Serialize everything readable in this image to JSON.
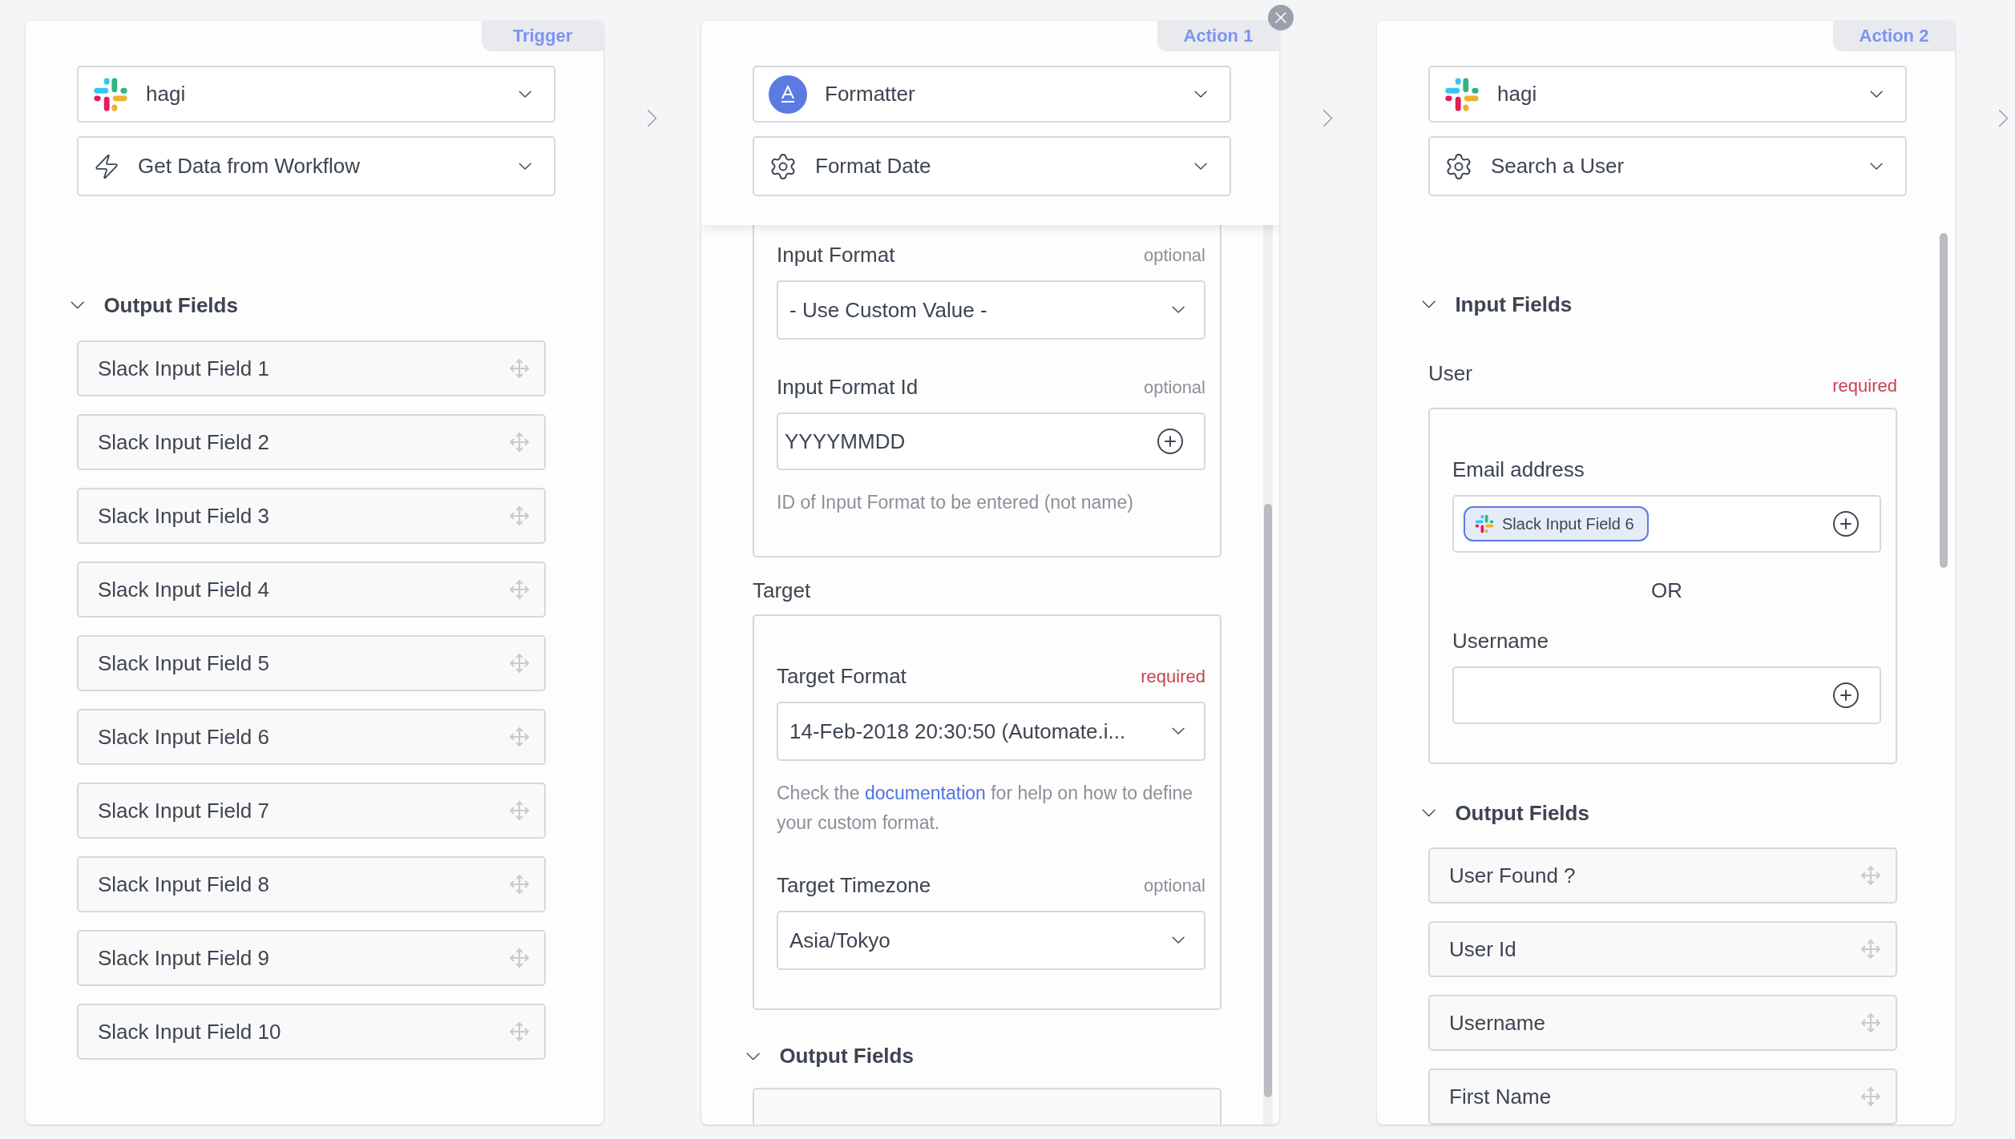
{
  "panels": [
    {
      "tab": "Trigger",
      "removable": false,
      "scrolled": false,
      "scrollbar": false,
      "app": {
        "label": "hagi"
      },
      "event": {
        "label": "Get Data from Workflow"
      },
      "sections": [
        {
          "kind": "heading",
          "title": "Output Fields",
          "expanded": true
        },
        {
          "kind": "output_fields",
          "items": [
            "Slack Input Field 1",
            "Slack Input Field 2",
            "Slack Input Field 3",
            "Slack Input Field 4",
            "Slack Input Field 5",
            "Slack Input Field 6",
            "Slack Input Field 7",
            "Slack Input Field 8",
            "Slack Input Field 9",
            "Slack Input Field 10"
          ]
        }
      ]
    },
    {
      "tab": "Action 1",
      "removable": true,
      "scrolled": true,
      "scrollbar": true,
      "app": {
        "label": "Formatter"
      },
      "event": {
        "label": "Format Date"
      },
      "sections": [
        {
          "kind": "group",
          "cut_top": true,
          "fields": [
            {
              "kind": "select",
              "label": "Input Format",
              "note": "optional",
              "required": false,
              "value": "- Use Custom Value -"
            },
            {
              "kind": "input",
              "label": "Input Format Id",
              "note": "optional",
              "required": false,
              "value": "YYYYMMDD",
              "help": {
                "text": "ID of Input Format to be entered (not name)"
              }
            }
          ]
        },
        {
          "kind": "group",
          "cut_top": false,
          "label": "Target",
          "fields": [
            {
              "kind": "select",
              "label": "Target Format",
              "note": "required",
              "required": true,
              "value": "14-Feb-2018 20:30:50 (Automate.i...",
              "help": {
                "before": "Check the ",
                "link": "documentation",
                "after": " for help on how to define your custom format."
              }
            },
            {
              "kind": "select",
              "label": "Target Timezone",
              "note": "optional",
              "required": false,
              "value": "Asia/Tokyo"
            }
          ]
        },
        {
          "kind": "heading",
          "title": "Output Fields",
          "expanded": true
        },
        {
          "kind": "partial_row"
        }
      ]
    },
    {
      "tab": "Action 2",
      "removable": false,
      "scrolled": false,
      "scrollbar": true,
      "app": {
        "label": "hagi"
      },
      "event": {
        "label": "Search a User"
      },
      "sections": [
        {
          "kind": "heading",
          "title": "Input Fields",
          "expanded": true
        },
        {
          "kind": "group",
          "cut_top": false,
          "label": "User",
          "note": "required",
          "required": true,
          "fields": [
            {
              "kind": "token_input",
              "label": "Email address",
              "token": {
                "label": "Slack Input Field 6"
              }
            },
            {
              "kind": "separator",
              "text": "OR"
            },
            {
              "kind": "input",
              "label": "Username"
            }
          ]
        },
        {
          "kind": "heading",
          "title": "Output Fields",
          "expanded": true
        },
        {
          "kind": "output_fields",
          "items": [
            "User Found ?",
            "User Id",
            "Username",
            "First Name"
          ]
        }
      ]
    }
  ]
}
